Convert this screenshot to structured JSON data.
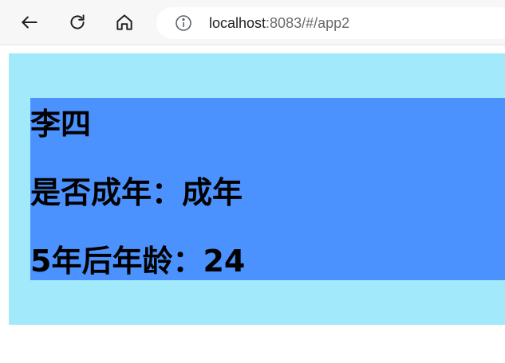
{
  "browser": {
    "url_host": "localhost",
    "url_path": ":8083/#/app2"
  },
  "page": {
    "name": "李四",
    "adult_label": "是否成年：",
    "adult_value": "成年",
    "age_label": "5年后年龄：",
    "age_value": "24"
  },
  "colors": {
    "outer_background": "#a3e9fc",
    "inner_background": "#4b92fe"
  }
}
